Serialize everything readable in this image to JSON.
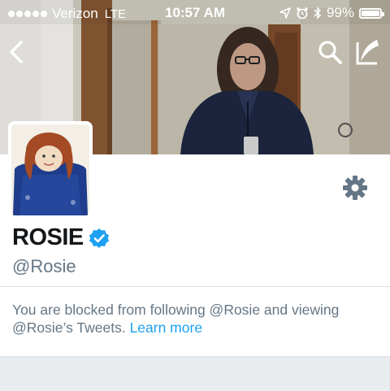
{
  "status_bar": {
    "carrier": "Verizon",
    "network": "LTE",
    "time": "10:57 AM",
    "battery_percent": "99%",
    "battery_level": 0.99,
    "signal_bars": 5
  },
  "nav": {
    "back_icon": "chevron-left-icon",
    "search_icon": "search-icon",
    "compose_icon": "compose-icon"
  },
  "profile": {
    "display_name": "ROSIE",
    "verified": true,
    "handle": "@Rosie",
    "settings_icon": "gear-icon"
  },
  "notice": {
    "text": "You are blocked from following @Rosie and viewing @Rosie’s Tweets.",
    "link_label": "Learn more"
  },
  "colors": {
    "accent": "#1da1f2",
    "text_primary": "#14171a",
    "text_secondary": "#657786",
    "verified_badge": "#1da1f2",
    "gear": "#657786"
  }
}
